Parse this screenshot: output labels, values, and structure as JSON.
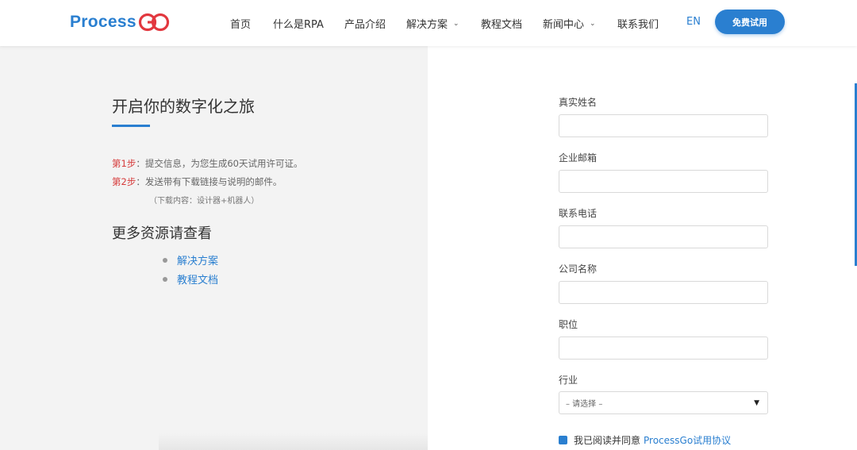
{
  "header": {
    "logo_text": "Process",
    "logo_suffix": "Go",
    "nav": [
      {
        "label": "首页"
      },
      {
        "label": "什么是RPA"
      },
      {
        "label": "产品介绍"
      },
      {
        "label": "解决方案",
        "dropdown": true
      },
      {
        "label": "教程文档"
      },
      {
        "label": "新闻中心",
        "dropdown": true
      },
      {
        "label": "联系我们"
      }
    ],
    "lang": "EN",
    "trial_button": "免费试用"
  },
  "left": {
    "title": "开启你的数字化之旅",
    "steps": [
      {
        "label": "第1步",
        "text": "：提交信息，为您生成60天试用许可证。"
      },
      {
        "label": "第2步",
        "text": "：发送带有下载链接与说明的邮件。"
      }
    ],
    "download_note": "（下载内容：设计器+机器人）",
    "resources_title": "更多资源请查看",
    "resources": [
      {
        "label": "解决方案"
      },
      {
        "label": "教程文档"
      }
    ]
  },
  "form": {
    "fields": [
      {
        "label": "真实姓名",
        "value": ""
      },
      {
        "label": "企业邮箱",
        "value": ""
      },
      {
        "label": "联系电话",
        "value": ""
      },
      {
        "label": "公司名称",
        "value": ""
      },
      {
        "label": "职位",
        "value": ""
      }
    ],
    "industry": {
      "label": "行业",
      "selected": "– 请选择 –"
    },
    "agreement": {
      "text": "我已阅读并同意",
      "link": "ProcessGo试用协议",
      "checked": true
    }
  },
  "colors": {
    "accent": "#2a7fd0",
    "step_label": "#d63b3b",
    "left_bg": "#f3f3f3"
  }
}
